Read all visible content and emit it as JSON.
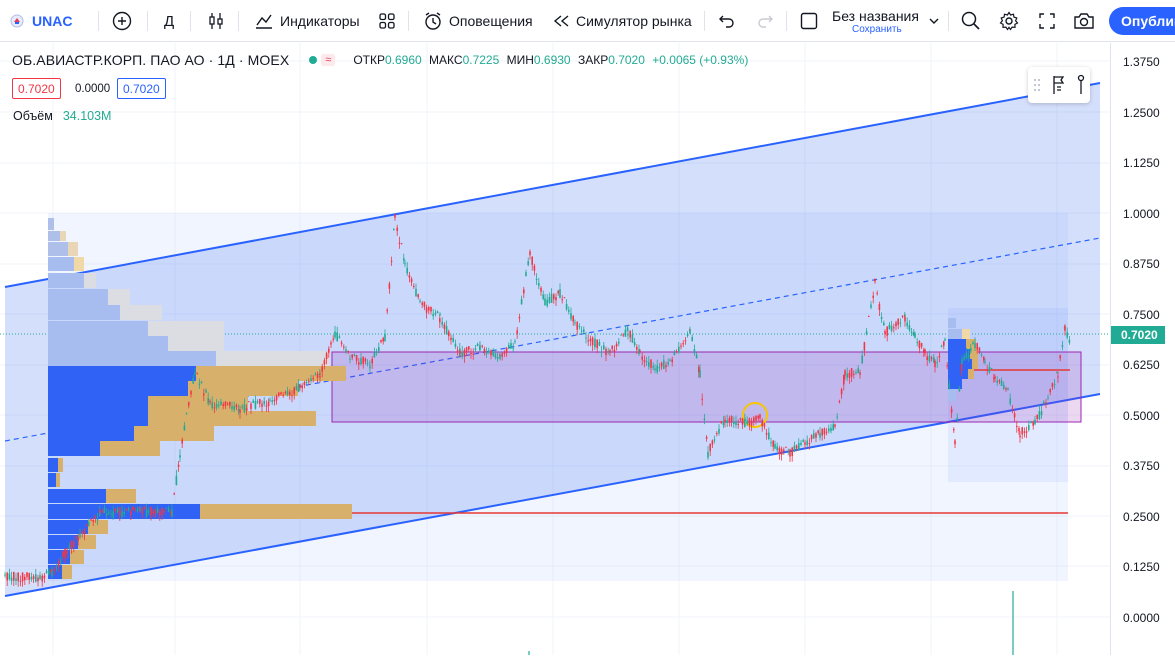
{
  "toolbar": {
    "symbol": "UNAC",
    "interval": "Д",
    "indicators_label": "Индикаторы",
    "alerts_label": "Оповещения",
    "replay_label": "Симулятор рынка",
    "layout_name": "Без названия",
    "layout_save": "Сохранить",
    "publish_label": "Опублик"
  },
  "legend": {
    "title": "ОБ.АВИАСТР.КОРП. ПАО АО · 1Д · MOEX",
    "open_label": "ОТКР",
    "open_value": "0.6960",
    "high_label": "МАКС",
    "high_value": "0.7225",
    "low_label": "МИН",
    "low_value": "0.6930",
    "close_label": "ЗАКР",
    "close_value": "0.7020",
    "change": "+0.0065 (+0.93%)",
    "bid": "0.7020",
    "spread": "0.0000",
    "ask": "0.7020",
    "volume_label": "Объём",
    "volume_value": "34.103M"
  },
  "price_axis": {
    "ticks": [
      "1.3750",
      "1.2500",
      "1.1250",
      "1.0000",
      "0.8750",
      "0.7500",
      "0.6250",
      "0.5000",
      "0.3750",
      "0.2500",
      "0.1250",
      "0.0000"
    ],
    "last_price": "0.7020"
  },
  "colors": {
    "up": "#22ab94",
    "down": "#f23645",
    "channel": "#2962ff",
    "range_box": "#9c27b0",
    "accent": "#2962ff"
  }
}
